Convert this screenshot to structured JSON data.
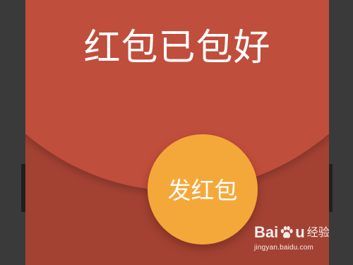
{
  "envelope": {
    "title": "红包已包好",
    "send_button_label": "发红包",
    "colors": {
      "flap": "#c04e3c",
      "body": "#a34233",
      "button": "#f5a83a",
      "frame": "#3a3a3a"
    }
  },
  "watermark": {
    "brand_left": "Bai",
    "brand_right": "u",
    "brand_suffix": "经验",
    "url": "jingyan.baidu.com",
    "icon": "paw-icon"
  }
}
